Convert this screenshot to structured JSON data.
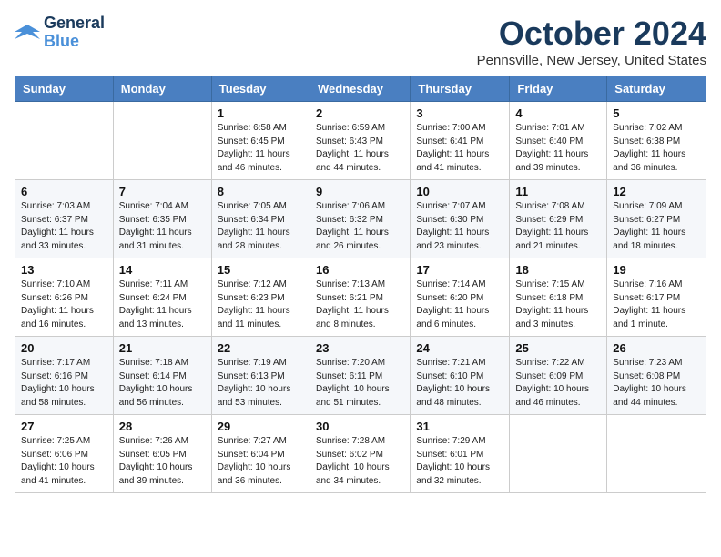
{
  "header": {
    "logo_line1": "General",
    "logo_line2": "Blue",
    "month": "October 2024",
    "location": "Pennsville, New Jersey, United States"
  },
  "weekdays": [
    "Sunday",
    "Monday",
    "Tuesday",
    "Wednesday",
    "Thursday",
    "Friday",
    "Saturday"
  ],
  "weeks": [
    [
      {
        "day": "",
        "info": ""
      },
      {
        "day": "",
        "info": ""
      },
      {
        "day": "1",
        "info": "Sunrise: 6:58 AM\nSunset: 6:45 PM\nDaylight: 11 hours and 46 minutes."
      },
      {
        "day": "2",
        "info": "Sunrise: 6:59 AM\nSunset: 6:43 PM\nDaylight: 11 hours and 44 minutes."
      },
      {
        "day": "3",
        "info": "Sunrise: 7:00 AM\nSunset: 6:41 PM\nDaylight: 11 hours and 41 minutes."
      },
      {
        "day": "4",
        "info": "Sunrise: 7:01 AM\nSunset: 6:40 PM\nDaylight: 11 hours and 39 minutes."
      },
      {
        "day": "5",
        "info": "Sunrise: 7:02 AM\nSunset: 6:38 PM\nDaylight: 11 hours and 36 minutes."
      }
    ],
    [
      {
        "day": "6",
        "info": "Sunrise: 7:03 AM\nSunset: 6:37 PM\nDaylight: 11 hours and 33 minutes."
      },
      {
        "day": "7",
        "info": "Sunrise: 7:04 AM\nSunset: 6:35 PM\nDaylight: 11 hours and 31 minutes."
      },
      {
        "day": "8",
        "info": "Sunrise: 7:05 AM\nSunset: 6:34 PM\nDaylight: 11 hours and 28 minutes."
      },
      {
        "day": "9",
        "info": "Sunrise: 7:06 AM\nSunset: 6:32 PM\nDaylight: 11 hours and 26 minutes."
      },
      {
        "day": "10",
        "info": "Sunrise: 7:07 AM\nSunset: 6:30 PM\nDaylight: 11 hours and 23 minutes."
      },
      {
        "day": "11",
        "info": "Sunrise: 7:08 AM\nSunset: 6:29 PM\nDaylight: 11 hours and 21 minutes."
      },
      {
        "day": "12",
        "info": "Sunrise: 7:09 AM\nSunset: 6:27 PM\nDaylight: 11 hours and 18 minutes."
      }
    ],
    [
      {
        "day": "13",
        "info": "Sunrise: 7:10 AM\nSunset: 6:26 PM\nDaylight: 11 hours and 16 minutes."
      },
      {
        "day": "14",
        "info": "Sunrise: 7:11 AM\nSunset: 6:24 PM\nDaylight: 11 hours and 13 minutes."
      },
      {
        "day": "15",
        "info": "Sunrise: 7:12 AM\nSunset: 6:23 PM\nDaylight: 11 hours and 11 minutes."
      },
      {
        "day": "16",
        "info": "Sunrise: 7:13 AM\nSunset: 6:21 PM\nDaylight: 11 hours and 8 minutes."
      },
      {
        "day": "17",
        "info": "Sunrise: 7:14 AM\nSunset: 6:20 PM\nDaylight: 11 hours and 6 minutes."
      },
      {
        "day": "18",
        "info": "Sunrise: 7:15 AM\nSunset: 6:18 PM\nDaylight: 11 hours and 3 minutes."
      },
      {
        "day": "19",
        "info": "Sunrise: 7:16 AM\nSunset: 6:17 PM\nDaylight: 11 hours and 1 minute."
      }
    ],
    [
      {
        "day": "20",
        "info": "Sunrise: 7:17 AM\nSunset: 6:16 PM\nDaylight: 10 hours and 58 minutes."
      },
      {
        "day": "21",
        "info": "Sunrise: 7:18 AM\nSunset: 6:14 PM\nDaylight: 10 hours and 56 minutes."
      },
      {
        "day": "22",
        "info": "Sunrise: 7:19 AM\nSunset: 6:13 PM\nDaylight: 10 hours and 53 minutes."
      },
      {
        "day": "23",
        "info": "Sunrise: 7:20 AM\nSunset: 6:11 PM\nDaylight: 10 hours and 51 minutes."
      },
      {
        "day": "24",
        "info": "Sunrise: 7:21 AM\nSunset: 6:10 PM\nDaylight: 10 hours and 48 minutes."
      },
      {
        "day": "25",
        "info": "Sunrise: 7:22 AM\nSunset: 6:09 PM\nDaylight: 10 hours and 46 minutes."
      },
      {
        "day": "26",
        "info": "Sunrise: 7:23 AM\nSunset: 6:08 PM\nDaylight: 10 hours and 44 minutes."
      }
    ],
    [
      {
        "day": "27",
        "info": "Sunrise: 7:25 AM\nSunset: 6:06 PM\nDaylight: 10 hours and 41 minutes."
      },
      {
        "day": "28",
        "info": "Sunrise: 7:26 AM\nSunset: 6:05 PM\nDaylight: 10 hours and 39 minutes."
      },
      {
        "day": "29",
        "info": "Sunrise: 7:27 AM\nSunset: 6:04 PM\nDaylight: 10 hours and 36 minutes."
      },
      {
        "day": "30",
        "info": "Sunrise: 7:28 AM\nSunset: 6:02 PM\nDaylight: 10 hours and 34 minutes."
      },
      {
        "day": "31",
        "info": "Sunrise: 7:29 AM\nSunset: 6:01 PM\nDaylight: 10 hours and 32 minutes."
      },
      {
        "day": "",
        "info": ""
      },
      {
        "day": "",
        "info": ""
      }
    ]
  ]
}
